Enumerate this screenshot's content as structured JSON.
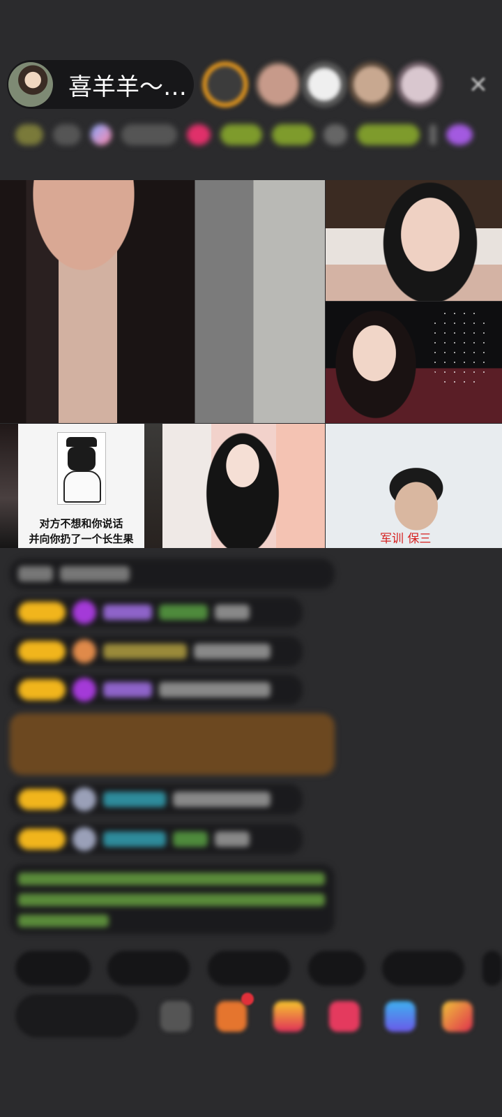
{
  "header": {
    "host_name": "喜羊羊～…"
  },
  "video_grid": {
    "meme_line1": "对方不想和你说话",
    "meme_line2": "并向你扔了一个长生果",
    "guy_caption": "军训 保三"
  },
  "colors": {
    "background": "#2b2b2d",
    "level_badge": "#f1b51c",
    "caption_red": "#d6201f"
  }
}
